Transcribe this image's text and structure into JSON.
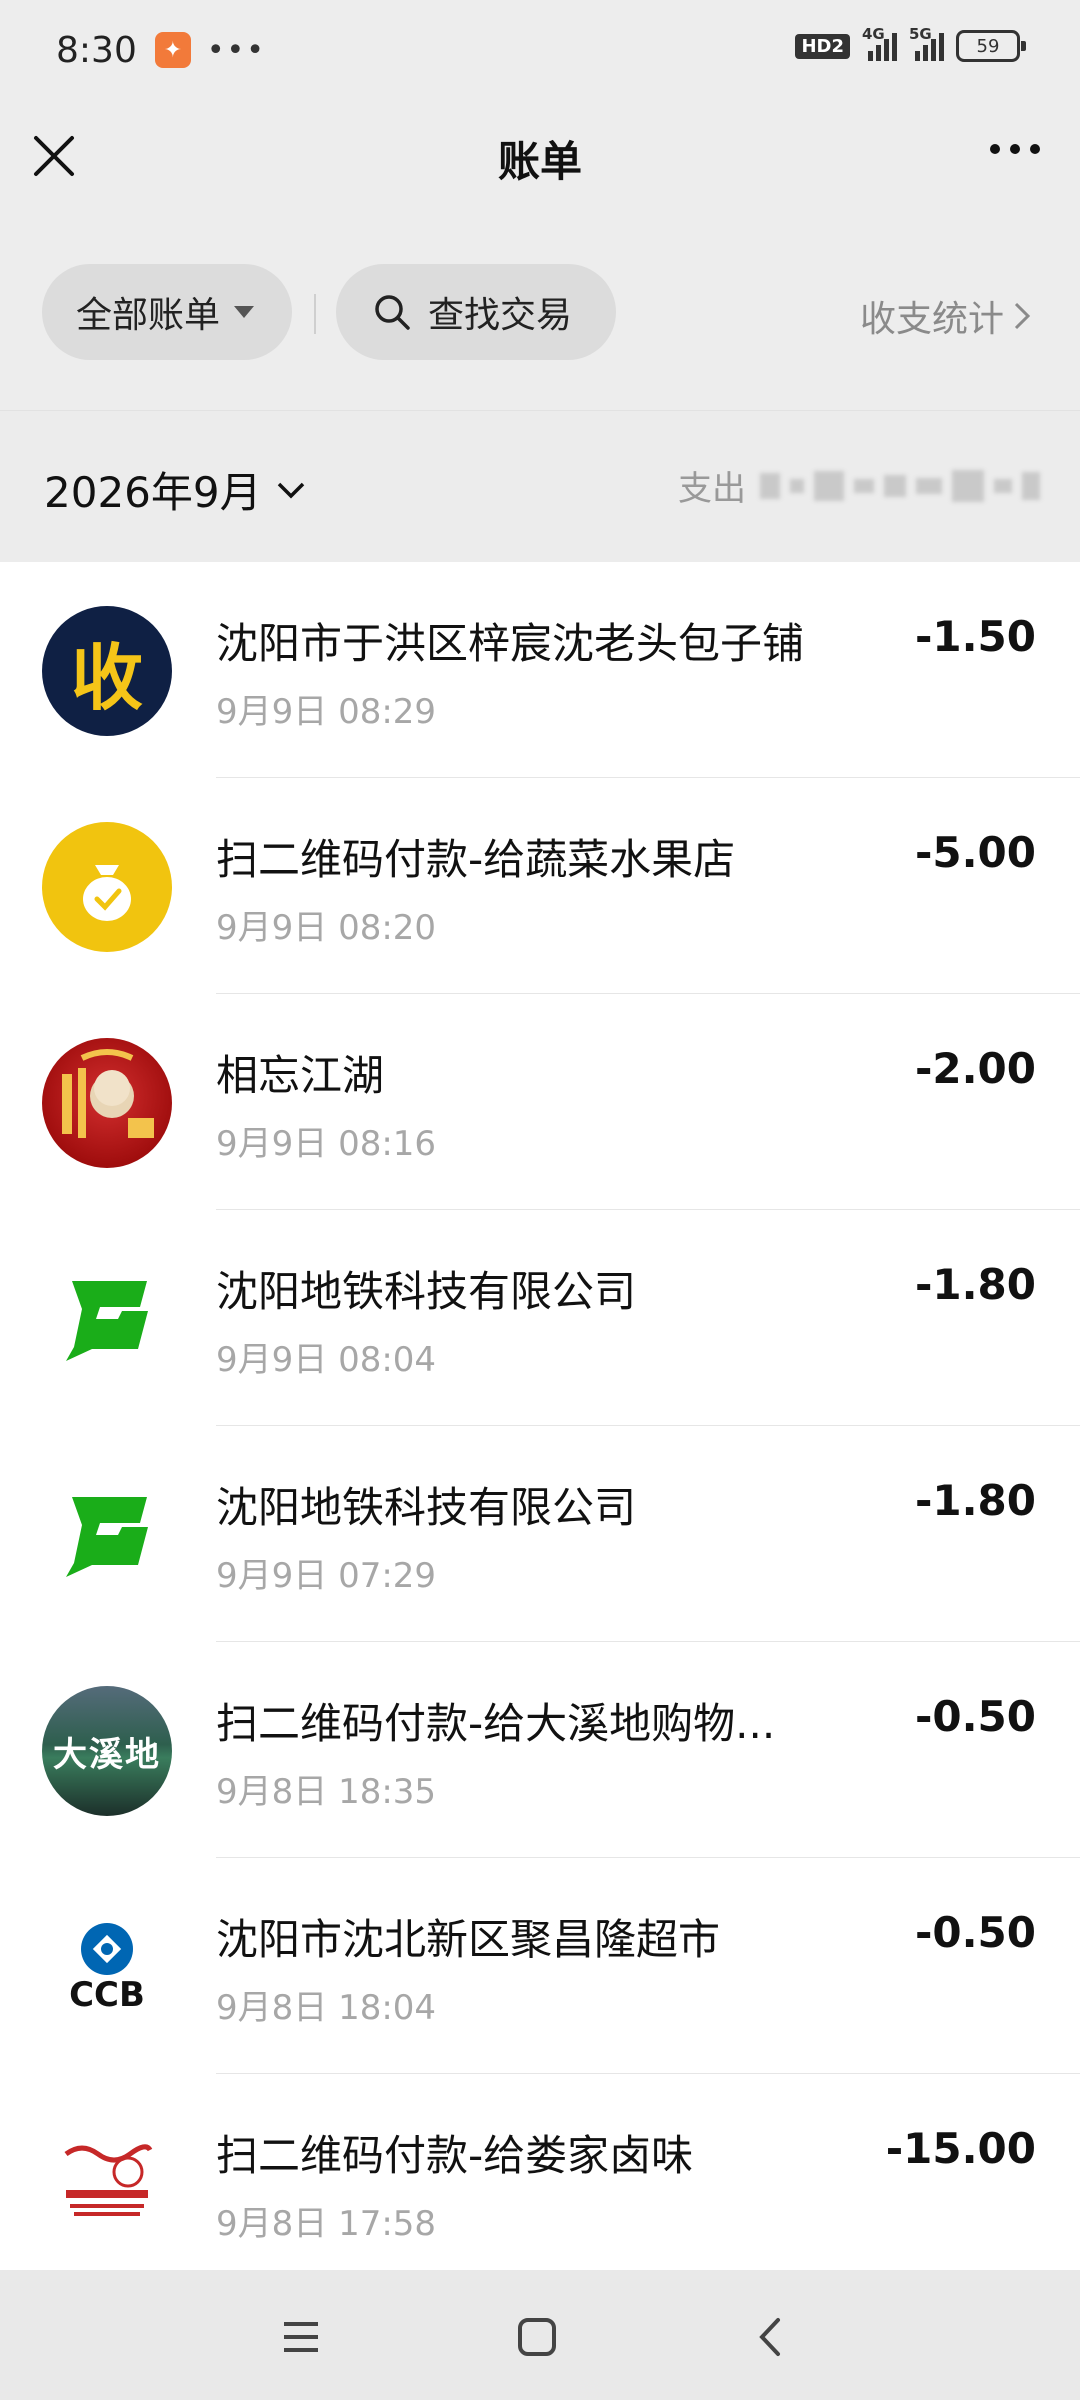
{
  "status_bar": {
    "time": "8:30",
    "network_badge": "HD2",
    "signal1_label": "4G",
    "signal2_label": "5G",
    "battery": "59"
  },
  "nav": {
    "title": "账单"
  },
  "filters": {
    "all_bills": "全部账单",
    "search": "查找交易",
    "stats": "收支统计"
  },
  "month": {
    "label": "2026年9月",
    "summary_prefix": "支出"
  },
  "transactions": [
    {
      "name": "沈阳市于洪区梓宸沈老头包子铺",
      "time": "9月9日 08:29",
      "amount": "-1.50",
      "icon": "shou-icon"
    },
    {
      "name": "扫二维码付款-给蔬菜水果店",
      "time": "9月9日 08:20",
      "amount": "-5.00",
      "icon": "money-bag-icon"
    },
    {
      "name": "相忘江湖",
      "time": "9月9日 08:16",
      "amount": "-2.00",
      "icon": "avatar-icon"
    },
    {
      "name": "沈阳地铁科技有限公司",
      "time": "9月9日 08:04",
      "amount": "-1.80",
      "icon": "metro-g-icon"
    },
    {
      "name": "沈阳地铁科技有限公司",
      "time": "9月9日 07:29",
      "amount": "-1.80",
      "icon": "metro-g-icon"
    },
    {
      "name": "扫二维码付款-给大溪地购物...",
      "time": "9月8日 18:35",
      "amount": "-0.50",
      "icon": "store-photo-icon"
    },
    {
      "name": "沈阳市沈北新区聚昌隆超市",
      "time": "9月8日 18:04",
      "amount": "-0.50",
      "icon": "ccb-icon"
    },
    {
      "name": "扫二维码付款-给娄家卤味",
      "time": "9月8日 17:58",
      "amount": "-15.00",
      "icon": "loujia-logo-icon"
    }
  ],
  "icon_texts": {
    "shou": "收",
    "ccb": "CCB",
    "store_sign": "大溪地"
  },
  "colors": {
    "amount": "#111111",
    "metro_green": "#1aad19",
    "shou_bg": "#0f2044",
    "shou_fg": "#f5c518",
    "bag_bg": "#f1c40f"
  }
}
